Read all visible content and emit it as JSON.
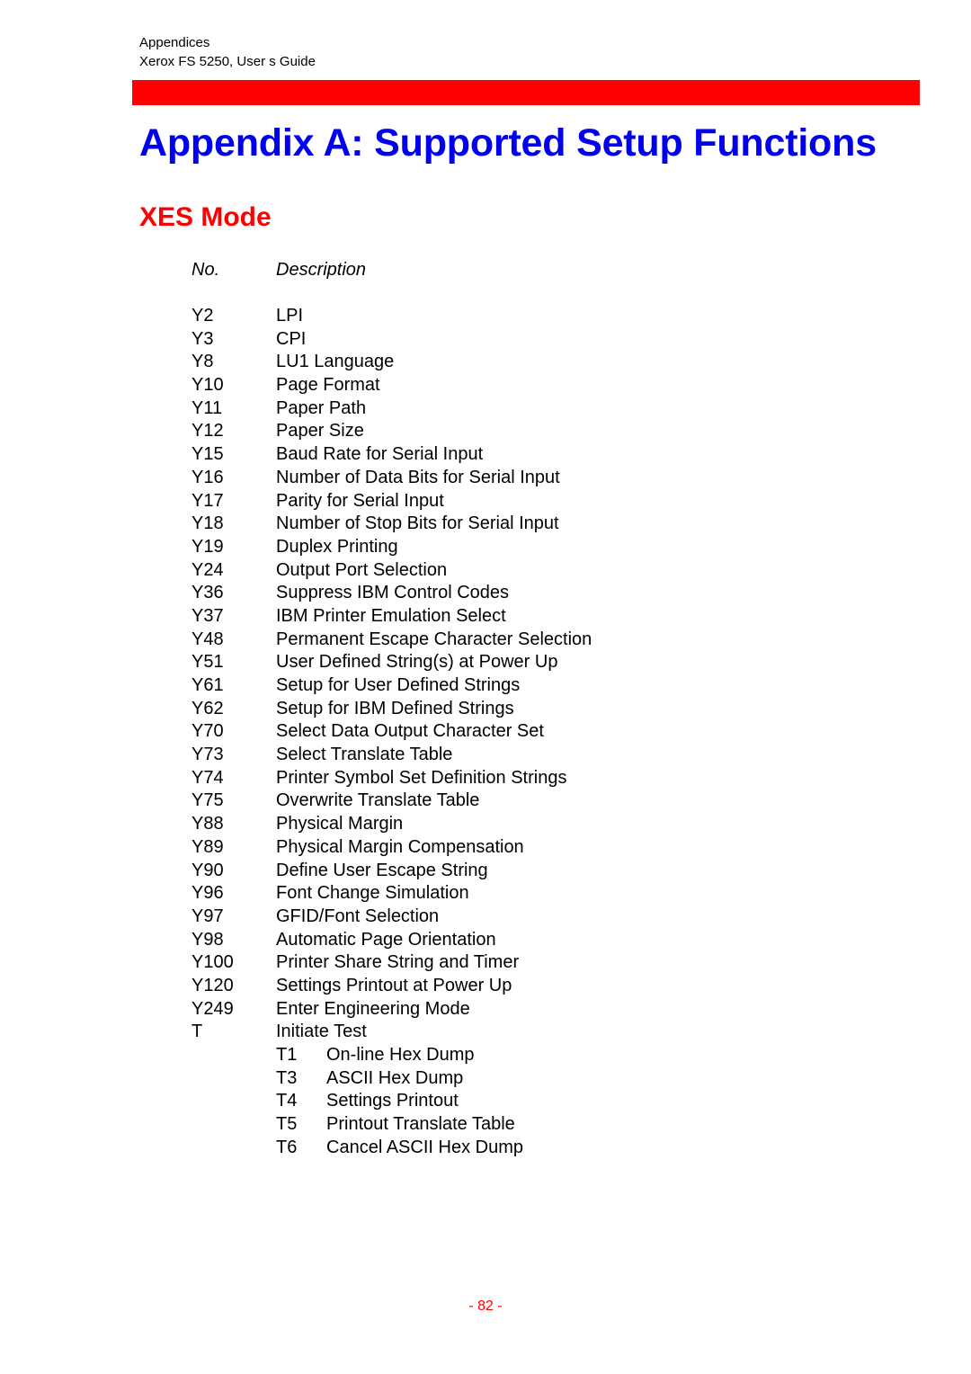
{
  "header": {
    "section": "Appendices",
    "guide": "Xerox FS 5250, User s Guide"
  },
  "colors": {
    "title": "#0000ee",
    "subtitle": "#ff0000",
    "bar": "#ff0000",
    "page_number": "#ff0000"
  },
  "title": "Appendix A: Supported Setup Functions",
  "subtitle": "XES Mode",
  "columns": {
    "no": "No.",
    "description": "Description"
  },
  "functions": [
    {
      "code": "Y2",
      "description": "LPI"
    },
    {
      "code": "Y3",
      "description": "CPI"
    },
    {
      "code": "Y8",
      "description": "LU1 Language"
    },
    {
      "code": "Y10",
      "description": "Page Format"
    },
    {
      "code": "Y11",
      "description": "Paper Path"
    },
    {
      "code": "Y12",
      "description": "Paper Size"
    },
    {
      "code": "Y15",
      "description": "Baud Rate for Serial Input"
    },
    {
      "code": "Y16",
      "description": "Number of Data Bits for Serial Input"
    },
    {
      "code": "Y17",
      "description": "Parity for Serial Input"
    },
    {
      "code": "Y18",
      "description": "Number of Stop Bits for Serial Input"
    },
    {
      "code": "Y19",
      "description": "Duplex Printing"
    },
    {
      "code": "Y24",
      "description": "Output Port Selection"
    },
    {
      "code": "Y36",
      "description": "Suppress IBM Control Codes"
    },
    {
      "code": "Y37",
      "description": "IBM Printer Emulation Select"
    },
    {
      "code": "Y48",
      "description": "Permanent Escape Character Selection"
    },
    {
      "code": "Y51",
      "description": "User Defined String(s) at Power Up"
    },
    {
      "code": "Y61",
      "description": "Setup for User Defined Strings"
    },
    {
      "code": "Y62",
      "description": "Setup for IBM Defined Strings"
    },
    {
      "code": "Y70",
      "description": "Select Data Output Character Set"
    },
    {
      "code": "Y73",
      "description": "Select Translate Table"
    },
    {
      "code": "Y74",
      "description": "Printer Symbol Set Definition Strings"
    },
    {
      "code": "Y75",
      "description": "Overwrite Translate Table"
    },
    {
      "code": "Y88",
      "description": "Physical Margin"
    },
    {
      "code": "Y89",
      "description": "Physical Margin Compensation"
    },
    {
      "code": "Y90",
      "description": "Define User Escape String"
    },
    {
      "code": "Y96",
      "description": "Font Change Simulation"
    },
    {
      "code": "Y97",
      "description": "GFID/Font Selection"
    },
    {
      "code": "Y98",
      "description": "Automatic Page Orientation"
    },
    {
      "code": "Y100",
      "description": "Printer Share String and Timer"
    },
    {
      "code": "Y120",
      "description": "Settings Printout at Power Up"
    },
    {
      "code": "Y249",
      "description": "Enter Engineering Mode"
    },
    {
      "code": "T",
      "description": "Initiate Test"
    }
  ],
  "tests": [
    {
      "code": "T1",
      "description": "On-line Hex Dump"
    },
    {
      "code": "T3",
      "description": "ASCII Hex Dump"
    },
    {
      "code": "T4",
      "description": "Settings Printout"
    },
    {
      "code": "T5",
      "description": "Printout Translate Table"
    },
    {
      "code": "T6",
      "description": "Cancel ASCII Hex Dump"
    }
  ],
  "footer": {
    "page_number": "- 82 -"
  }
}
